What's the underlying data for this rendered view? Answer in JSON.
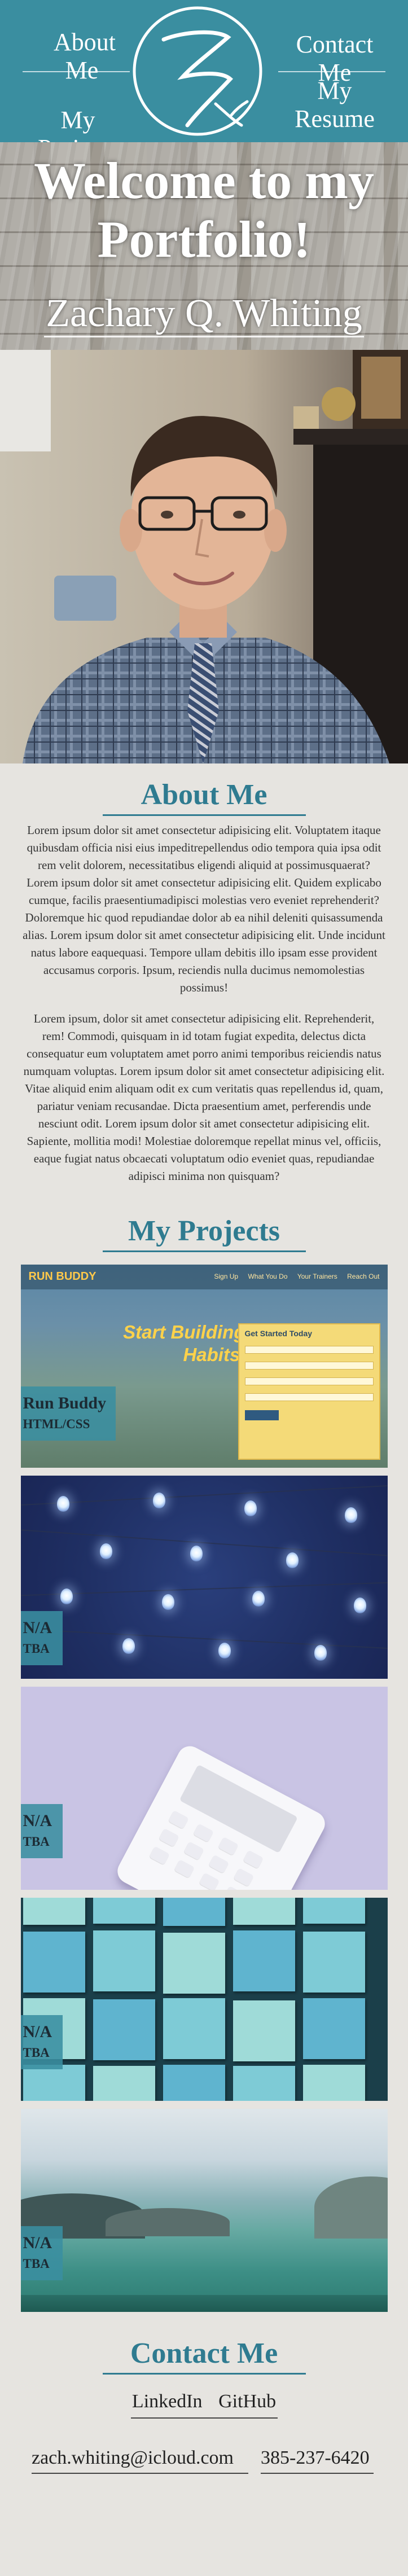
{
  "nav": {
    "about": "About Me",
    "projects": "My Projects",
    "contact": "Contact Me",
    "resume": "My Resume"
  },
  "hero": {
    "title": "Welcome to my Portfolio!",
    "name": "Zachary Q. Whiting"
  },
  "about": {
    "title": "About Me",
    "paragraphs": [
      "Lorem ipsum dolor sit amet consectetur adipisicing elit. Voluptatem itaque quibusdam officia nisi eius impeditrepellendus odio tempora quia ipsa odit rem velit dolorem, necessitatibus eligendi aliquid at possimusquaerat? Lorem ipsum dolor sit amet consectetur adipisicing elit. Quidem explicabo cumque, facilis praesentiumadipisci molestias vero eveniet reprehenderit? Doloremque hic quod repudiandae dolor ab ea nihil deleniti quisassumenda alias. Lorem ipsum dolor sit amet consectetur adipisicing elit. Unde incidunt natus labore eaquequasi. Tempore ullam debitis illo ipsam esse provident accusamus corporis. Ipsum, reciendis nulla ducimus nemomolestias possimus!",
      "Lorem ipsum, dolor sit amet consectetur adipisicing elit. Reprehenderit, rem! Commodi, quisquam in id totam fugiat expedita, delectus dicta consequatur eum voluptatem amet porro animi temporibus reiciendis natus numquam voluptas. Lorem ipsum dolor sit amet consectetur adipisicing elit. Vitae aliquid enim aliquam odit ex cum veritatis quas repellendus id, quam, pariatur veniam recusandae. Dicta praesentium amet, perferendis unde nesciunt odit. Lorem ipsum dolor sit amet consectetur adipisicing elit. Sapiente, mollitia modi! Molestiae doloremque repellat minus vel, officiis, eaque fugiat natus obcaecati voluptatum odio eveniet quas, repudiandae adipisci minima non quisquam?"
    ]
  },
  "projects": {
    "title": "My Projects",
    "items": [
      {
        "name": "Run Buddy",
        "tech": "HTML/CSS",
        "screenshot": {
          "logo": "RUN BUDDY",
          "nav_links": [
            "Sign Up",
            "What You Do",
            "Your Trainers",
            "Reach Out"
          ],
          "headline": "Start Building Habits.",
          "form_title": "Get Started Today"
        }
      },
      {
        "name": "N/A",
        "tech": "TBA"
      },
      {
        "name": "N/A",
        "tech": "TBA"
      },
      {
        "name": "N/A",
        "tech": "TBA"
      },
      {
        "name": "N/A",
        "tech": "TBA"
      }
    ]
  },
  "contact": {
    "title": "Contact Me",
    "linkedin": "LinkedIn",
    "github": "GitHub",
    "email": "zach.whiting@icloud.com",
    "phone": "385-237-6420"
  },
  "colors": {
    "nav_bg": "#3a8ea0",
    "accent": "#2f7b90",
    "page_bg": "#e6e4e0"
  }
}
